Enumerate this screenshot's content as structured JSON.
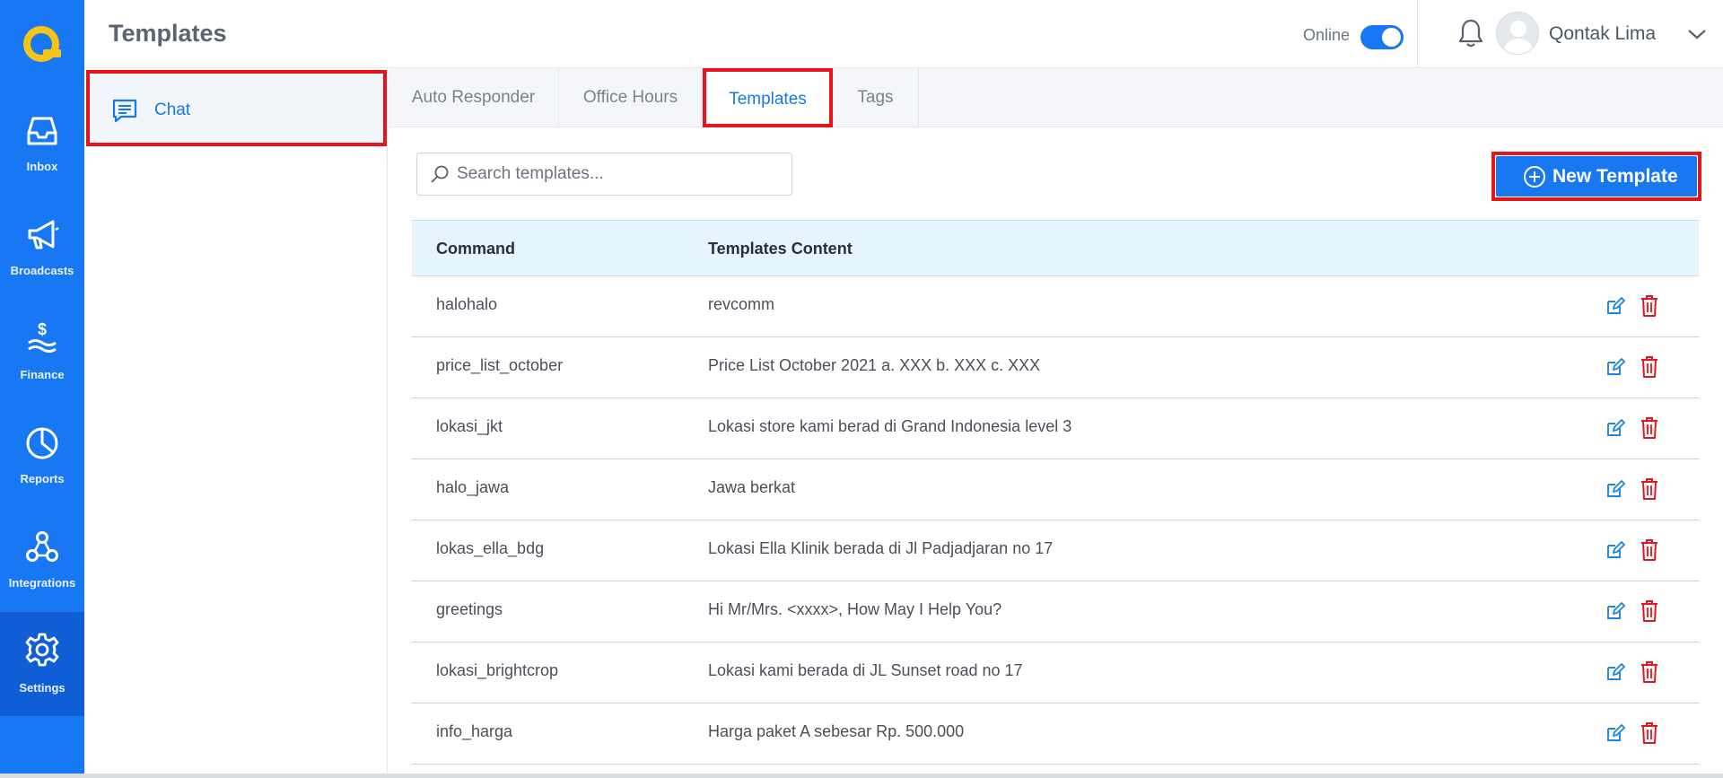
{
  "app": {
    "brand_color": "#1877f2",
    "accent_red": "#e8141c"
  },
  "rail": {
    "items": [
      {
        "label": "Inbox",
        "icon": "inbox-icon",
        "active": false
      },
      {
        "label": "Broadcasts",
        "icon": "megaphone-icon",
        "active": false
      },
      {
        "label": "Finance",
        "icon": "finance-icon",
        "active": false
      },
      {
        "label": "Reports",
        "icon": "pie-chart-icon",
        "active": false
      },
      {
        "label": "Integrations",
        "icon": "integrations-icon",
        "active": false
      },
      {
        "label": "Settings",
        "icon": "gear-icon",
        "active": true
      }
    ]
  },
  "header": {
    "title": "Templates",
    "online_label": "Online",
    "online": true,
    "user_name": "Qontak Lima"
  },
  "subnav": {
    "items": [
      {
        "label": "Chat",
        "icon": "chat-icon",
        "active": true
      }
    ]
  },
  "tabs": [
    {
      "label": "Auto Responder",
      "active": false
    },
    {
      "label": "Office Hours",
      "active": false
    },
    {
      "label": "Templates",
      "active": true
    },
    {
      "label": "Tags",
      "active": false
    }
  ],
  "search": {
    "placeholder": "Search templates..."
  },
  "new_template_button": {
    "label": "New Template"
  },
  "table": {
    "columns": [
      "Command",
      "Templates Content"
    ],
    "rows": [
      {
        "command": "halohalo",
        "content": "revcomm"
      },
      {
        "command": "price_list_october",
        "content": "Price List October 2021 a. XXX b. XXX c. XXX"
      },
      {
        "command": "lokasi_jkt",
        "content": "Lokasi store kami berad di Grand Indonesia level 3"
      },
      {
        "command": "halo_jawa",
        "content": "Jawa berkat"
      },
      {
        "command": "lokas_ella_bdg",
        "content": "Lokasi Ella Klinik berada di Jl Padjadjaran no 17"
      },
      {
        "command": "greetings",
        "content": "Hi Mr/Mrs. <xxxx>, How May I Help You?"
      },
      {
        "command": "lokasi_brightcrop",
        "content": "Lokasi kami berada di JL Sunset road no 17"
      },
      {
        "command": "info_harga",
        "content": "Harga paket A sebesar Rp. 500.000"
      }
    ]
  }
}
